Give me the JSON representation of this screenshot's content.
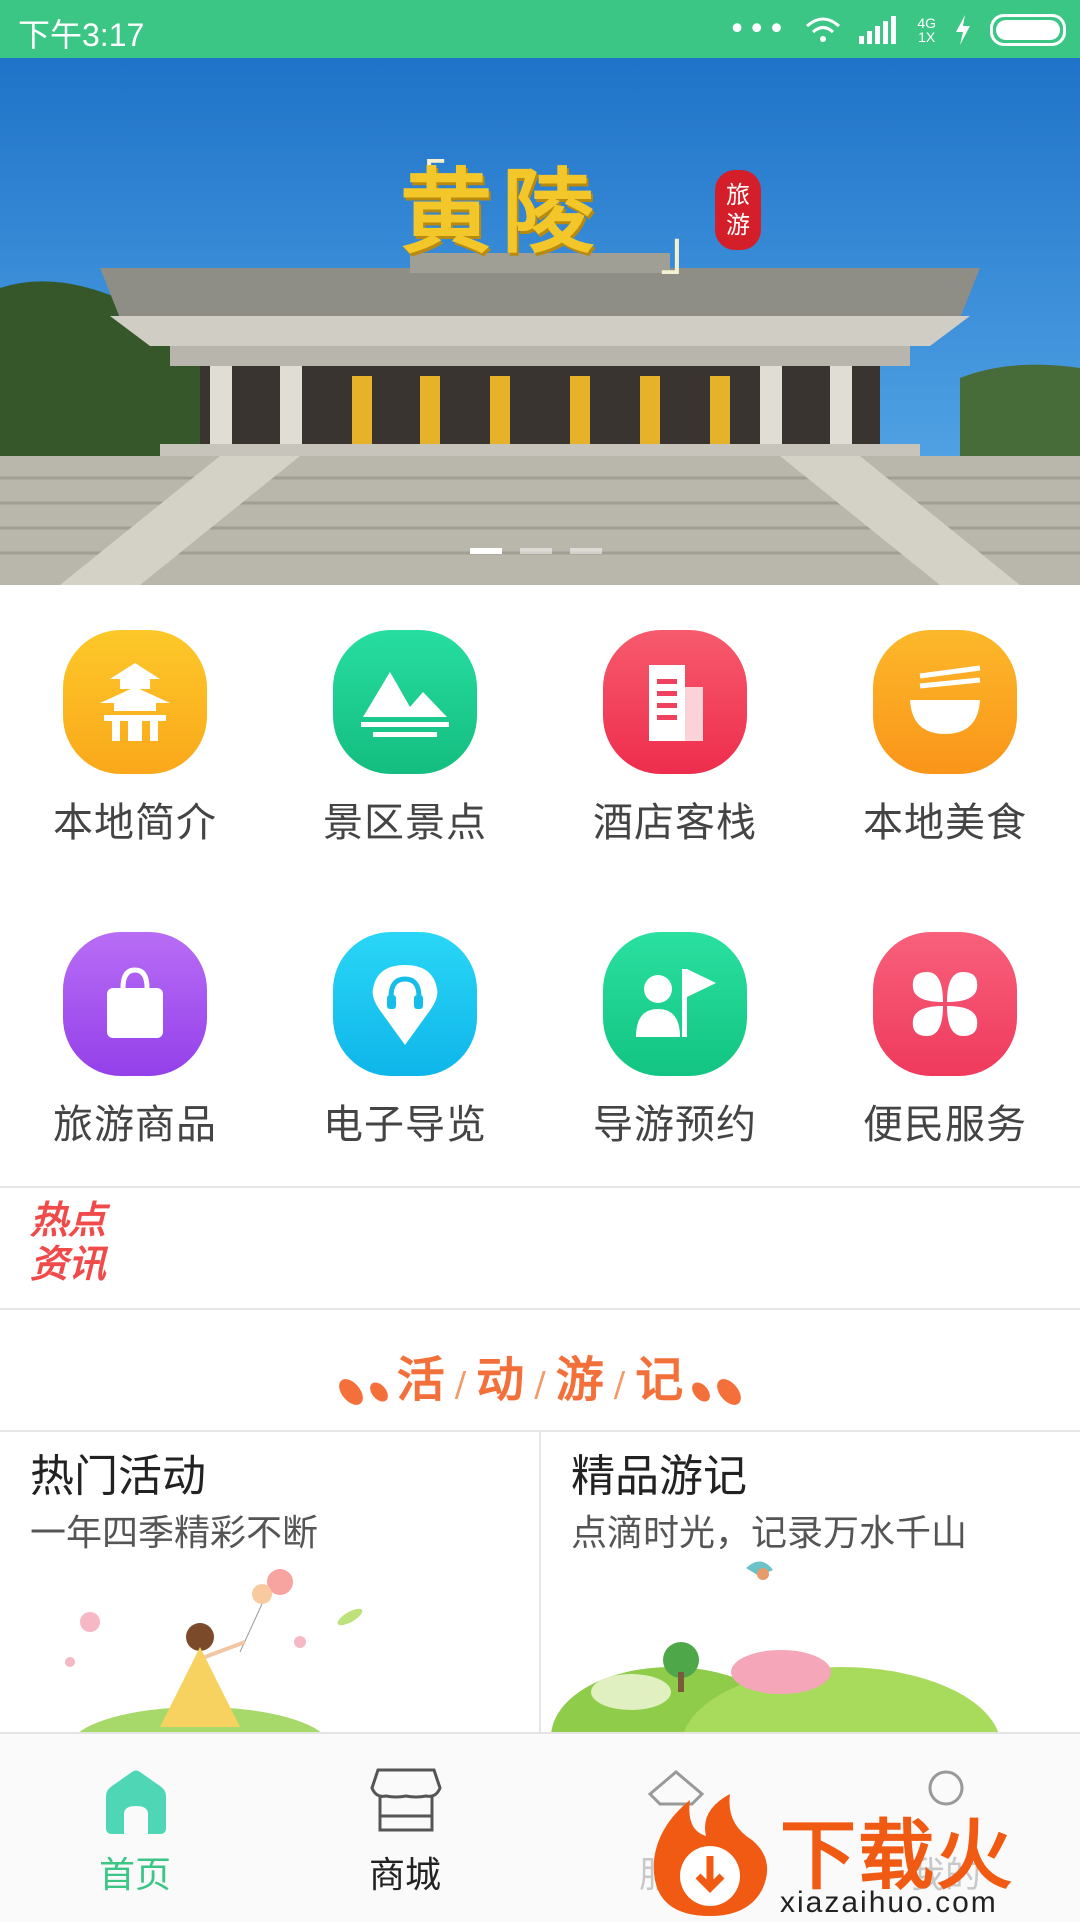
{
  "status_bar": {
    "time": "下午3:17",
    "dots": "•••",
    "network_top": "4G",
    "network_bottom": "1X"
  },
  "banner": {
    "title": "黄陵",
    "seal_line1": "旅",
    "seal_line2": "游",
    "slides": 3,
    "active_slide": 0
  },
  "grid": {
    "items": [
      {
        "label": "本地简介",
        "icon": "pagoda-icon",
        "color": "#fcb619"
      },
      {
        "label": "景区景点",
        "icon": "mountain-icon",
        "color": "#1cc98e"
      },
      {
        "label": "酒店客栈",
        "icon": "building-icon",
        "color": "#f3405a"
      },
      {
        "label": "本地美食",
        "icon": "bowl-icon",
        "color": "#fba21b"
      },
      {
        "label": "旅游商品",
        "icon": "shopping-bag-icon",
        "color": "#a855f0"
      },
      {
        "label": "电子导览",
        "icon": "audio-guide-pin-icon",
        "color": "#18c6f2"
      },
      {
        "label": "导游预约",
        "icon": "guide-flag-icon",
        "color": "#1ccf8c"
      },
      {
        "label": "便民服务",
        "icon": "petals-icon",
        "color": "#f34a6a"
      }
    ]
  },
  "hot_news": {
    "label_line1": "热点",
    "label_line2": "资讯"
  },
  "activities": {
    "title_chars": [
      "活",
      "动",
      "游",
      "记"
    ],
    "separator": "/",
    "cards": [
      {
        "title": "热门活动",
        "subtitle": "一年四季精彩不断"
      },
      {
        "title": "精品游记",
        "subtitle": "点滴时光，记录万水千山"
      }
    ]
  },
  "tabbar": {
    "tabs": [
      {
        "label": "首页",
        "icon": "home-icon",
        "active": true
      },
      {
        "label": "商城",
        "icon": "shop-icon",
        "active": false
      },
      {
        "label": "服务",
        "icon": "service-icon",
        "active": false
      },
      {
        "label": "我的",
        "icon": "profile-icon",
        "active": false
      }
    ]
  },
  "watermark": {
    "text": "下载火",
    "url": "xiazaihuo.com"
  },
  "colors": {
    "accent": "#3cc686",
    "activity_title": "#f3703a",
    "hot_news": "#f04a4a"
  }
}
